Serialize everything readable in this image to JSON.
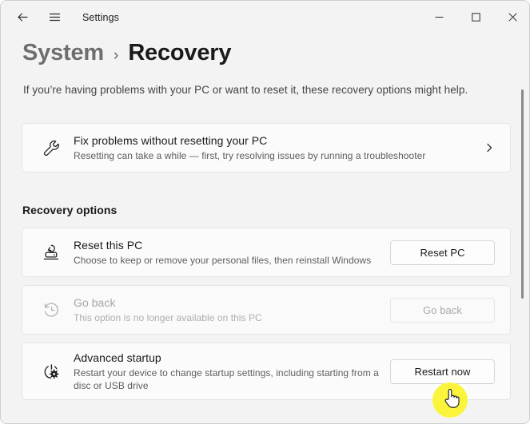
{
  "window": {
    "app_title": "Settings",
    "back_icon": "back-arrow-icon",
    "menu_icon": "hamburger-menu-icon",
    "minimize_icon": "minimize-icon",
    "maximize_icon": "maximize-icon",
    "close_icon": "close-icon"
  },
  "page": {
    "breadcrumb_parent": "System",
    "breadcrumb_separator": "›",
    "breadcrumb_current": "Recovery",
    "description": "If you’re having problems with your PC or want to reset it, these recovery options might help.",
    "section_heading": "Recovery options"
  },
  "cards": {
    "fix_problems": {
      "icon": "wrench-icon",
      "title": "Fix problems without resetting your PC",
      "subtitle": "Resetting can take a while — first, try resolving issues by running a troubleshooter",
      "chevron_icon": "chevron-right-icon"
    },
    "reset_pc": {
      "icon": "reset-pc-icon",
      "title": "Reset this PC",
      "subtitle": "Choose to keep or remove your personal files, then reinstall Windows",
      "button_label": "Reset PC"
    },
    "go_back": {
      "icon": "history-clock-icon",
      "title": "Go back",
      "subtitle": "This option is no longer available on this PC",
      "button_label": "Go back",
      "disabled": true
    },
    "advanced_startup": {
      "icon": "power-gear-icon",
      "title": "Advanced startup",
      "subtitle": "Restart your device to change startup settings, including starting from a disc or USB drive",
      "button_label": "Restart now"
    }
  },
  "colors": {
    "window_background": "#f3f3f3",
    "card_background": "#fbfbfb",
    "card_border": "#e5e5e5",
    "cursor_highlight": "#fbf43c",
    "scrollbar_thumb": "#8a8a8a"
  },
  "cursor": {
    "icon": "hand-pointer-cursor",
    "highlight_icon": "click-highlight-circle"
  }
}
